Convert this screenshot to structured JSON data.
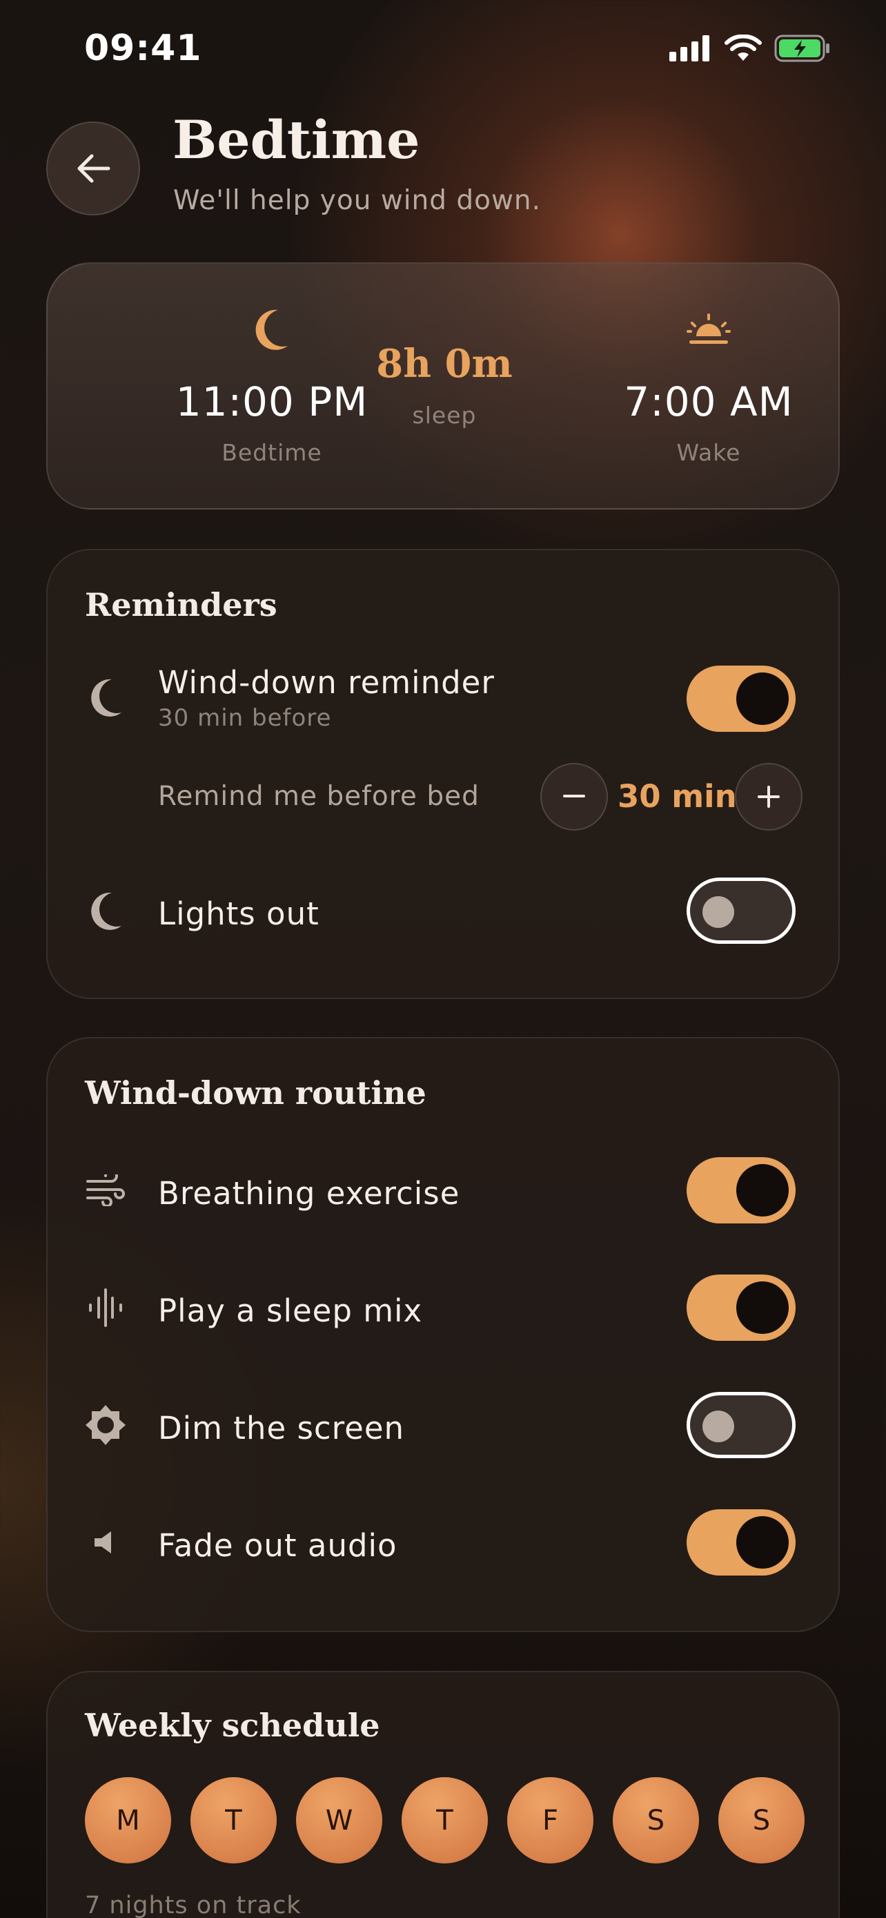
{
  "status_bar": {
    "time": "09:41"
  },
  "header": {
    "title": "Bedtime",
    "subtitle": "We'll help you wind down."
  },
  "summary": {
    "bedtime": {
      "time": "11:00 PM",
      "label": "Bedtime"
    },
    "duration": {
      "value": "8h 0m",
      "label": "sleep"
    },
    "wake": {
      "time": "7:00 AM",
      "label": "Wake"
    }
  },
  "reminders": {
    "title": "Reminders",
    "wind_down": {
      "label": "Wind-down reminder",
      "sub": "30 min before",
      "on": true
    },
    "stepper": {
      "label": "Remind me before bed",
      "value": "30 min"
    },
    "lights_out": {
      "label": "Lights out",
      "on": false
    }
  },
  "routine": {
    "title": "Wind-down routine",
    "items": [
      {
        "label": "Breathing exercise",
        "icon": "wind-icon",
        "on": true
      },
      {
        "label": "Play a sleep mix",
        "icon": "soundwave-icon",
        "on": true
      },
      {
        "label": "Dim the screen",
        "icon": "brightness-icon",
        "on": false
      },
      {
        "label": "Fade out audio",
        "icon": "speaker-icon",
        "on": true
      }
    ]
  },
  "schedule": {
    "title": "Weekly schedule",
    "days": [
      "M",
      "T",
      "W",
      "T",
      "F",
      "S",
      "S"
    ],
    "note": "7 nights on track"
  },
  "colors": {
    "accent": "#e8a35e",
    "background": "#1d1613",
    "card": "#261d19"
  }
}
